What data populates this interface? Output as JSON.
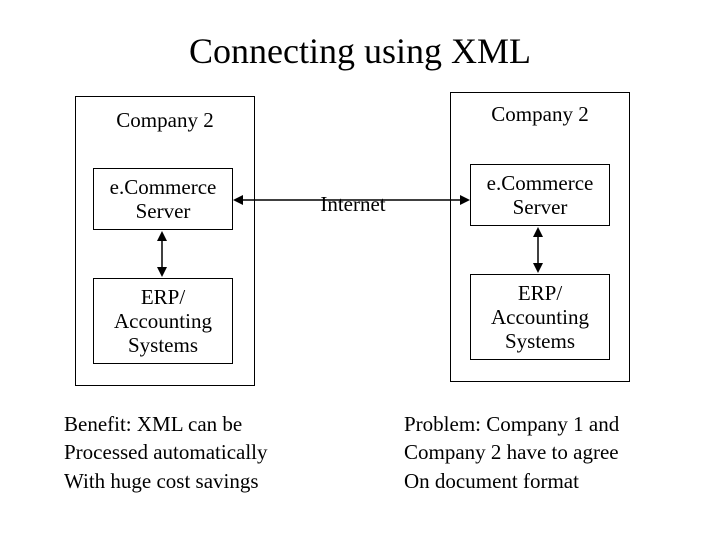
{
  "title": "Connecting using XML",
  "left": {
    "company_label": "Company 2",
    "ecom": "e.Commerce\nServer",
    "erp": "ERP/\nAccounting\nSystems"
  },
  "right": {
    "company_label": "Company 2",
    "ecom": "e.Commerce\nServer",
    "erp": "ERP/\nAccounting\nSystems"
  },
  "center_label": "Internet",
  "benefit": "Benefit: XML can be\nProcessed automatically\nWith huge cost savings",
  "problem": "Problem: Company 1 and\nCompany 2 have to agree\nOn document format"
}
